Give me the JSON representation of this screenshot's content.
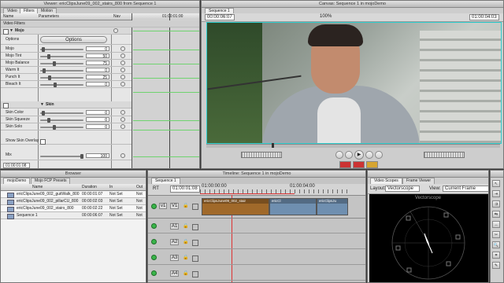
{
  "viewer": {
    "title": "Viewer: ericClipsJune09_002_stairs_800 from Sequence 1",
    "tabs": [
      "Video",
      "Filters",
      "Motion"
    ],
    "columns": {
      "name": "Name",
      "parameters": "Parameters",
      "nav": "Nav"
    },
    "ruler_time": "01:00:01:00",
    "section_video_filters": "Video Filters",
    "filter_name": "Mojo",
    "options_label": "Options",
    "options_button": "Options",
    "params": [
      {
        "label": "Mojo",
        "value": "0"
      },
      {
        "label": "Mojo Tint",
        "value": "50"
      },
      {
        "label": "Mojo Balance",
        "value": "75"
      },
      {
        "label": "Warm It",
        "value": "0"
      },
      {
        "label": "Punch It",
        "value": "25"
      },
      {
        "label": "Bleach It",
        "value": "0"
      }
    ],
    "skin_section": "Skin",
    "skin_params": [
      {
        "label": "Skin Color",
        "value": "0"
      },
      {
        "label": "Skin Squeeze",
        "value": "0"
      },
      {
        "label": "Skin Solo",
        "value": "0"
      }
    ],
    "show_skin_overlay": "Show Skin Overlay",
    "mix_label": "Mix",
    "mix_value": "100",
    "timecode": "01:00:01:08"
  },
  "canvas": {
    "title": "Canvas: Sequence 1 in mojoDemo",
    "tab": "Sequence 1",
    "timecode_left": "00:00:06:07",
    "timecode_right": "01:00:04:03",
    "zoom": "100%"
  },
  "browser": {
    "title": "Browser",
    "tabs": [
      "mojoDemo",
      "Mojo FCP Presets"
    ],
    "columns": [
      "Name",
      "Duration",
      "In",
      "Out"
    ],
    "items": [
      {
        "name": "ericClipsJune09_002_guitWalk_800",
        "duration": "00:00:01:07",
        "in": "Not Set",
        "out": "Not"
      },
      {
        "name": "ericClipsJune09_002_pillarCU_800",
        "duration": "00:00:02:03",
        "in": "Not Set",
        "out": "Not"
      },
      {
        "name": "ericClipsJune09_002_stairs_800",
        "duration": "00:00:02:22",
        "in": "Not Set",
        "out": "Not"
      },
      {
        "name": "Sequence 1",
        "duration": "00:00:06:07",
        "in": "Not Set",
        "out": "Not"
      }
    ]
  },
  "timeline": {
    "title": "Timeline: Sequence 1 in mojoDemo",
    "tab": "Sequence 1",
    "rt_label": "RT",
    "timecode": "01:00:01:08",
    "ruler_start": "01:00:00:00",
    "ruler_mid": "01:00:04:00",
    "video_track": {
      "source": "v1",
      "dest": "V1"
    },
    "clips": [
      {
        "name": "ericClipsJune09_002_stair",
        "color": "#a0692a"
      },
      {
        "name": "ericCl",
        "color": "#6f8fb0"
      },
      {
        "name": "ericClipsJu",
        "color": "#6f8fb0"
      }
    ],
    "audio_tracks": [
      "A1",
      "A2",
      "A3",
      "A4"
    ]
  },
  "scopes": {
    "tabs": [
      "Video Scopes",
      "Frame Viewer"
    ],
    "layout_label": "Layout:",
    "layout_value": "Vectorscope",
    "view_label": "View:",
    "view_value": "Current Frame",
    "scope_title": "Vectorscope"
  },
  "tools": {
    "title": "Tools",
    "icons": [
      "selection-tool-icon",
      "edit-select-tool-icon",
      "track-select-tool-icon",
      "roll-tool-icon",
      "slip-tool-icon",
      "razor-tool-icon",
      "zoom-tool-icon",
      "crop-tool-icon",
      "pen-tool-icon"
    ]
  },
  "colors": {
    "accent_green": "#39b54a",
    "clip_selected": "#a0692a",
    "clip_blue": "#6f8fb0",
    "scope_bg": "#000000"
  }
}
